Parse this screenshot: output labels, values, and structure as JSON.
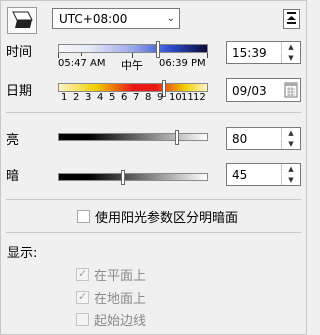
{
  "timezone": {
    "value": "UTC+08:00"
  },
  "time": {
    "label": "时间",
    "sunrise_label": "05:47 AM",
    "noon_label": "中午",
    "sunset_label": "06:39 PM",
    "value": "15:39",
    "slider_fraction": 0.65
  },
  "date": {
    "label": "日期",
    "month_labels": [
      "1",
      "2",
      "3",
      "4",
      "5",
      "6",
      "7",
      "8",
      "9",
      "10",
      "11",
      "12"
    ],
    "value": "09/03",
    "slider_fraction": 0.69
  },
  "light": {
    "label": "亮",
    "value": "80"
  },
  "dark": {
    "label": "暗",
    "value": "45"
  },
  "shadow_option": {
    "label": "使用阳光参数区分明暗面",
    "checked": false
  },
  "display": {
    "label": "显示:",
    "on_faces_label": "在平面上",
    "on_ground_label": "在地面上",
    "from_edges_label": "起始边线"
  },
  "colors": {
    "accent_blue": "#2f4fd0",
    "accent_red": "#d42020",
    "accent_yellow": "#f0d000"
  }
}
